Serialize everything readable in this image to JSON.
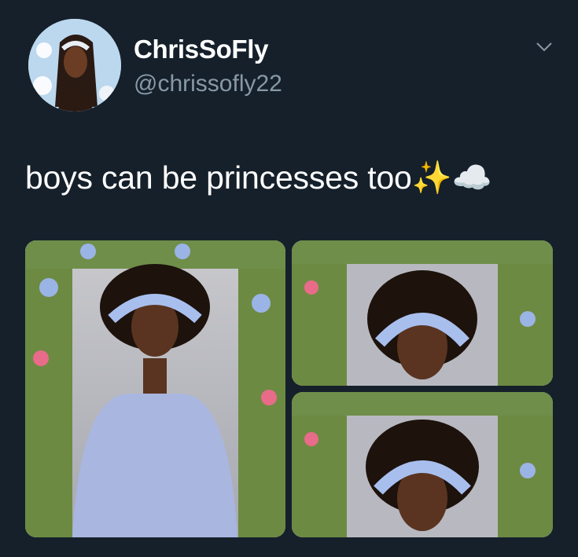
{
  "tweet": {
    "display_name": "ChrisSoFly",
    "handle": "@chrissofly22",
    "text": "boys can be princesses too✨☁️"
  },
  "icons": {
    "more": "chevron-down-icon",
    "sparkles": "sparkles-emoji",
    "cloud": "cloud-emoji"
  },
  "colors": {
    "background": "#15202b",
    "name_text": "#ffffff",
    "handle_text": "#8899a6"
  }
}
